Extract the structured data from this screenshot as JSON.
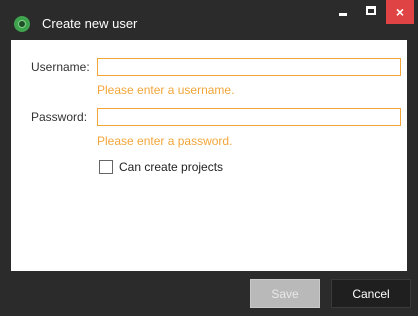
{
  "window": {
    "title": "Create new user",
    "controls": {
      "minimize_icon": "minimize-icon",
      "maximize_icon": "maximize-icon",
      "close_icon": "close-icon",
      "close_glyph": "×"
    }
  },
  "form": {
    "username": {
      "label": "Username:",
      "value": "",
      "error": "Please enter a username."
    },
    "password": {
      "label": "Password:",
      "value": "",
      "error": "Please enter a password."
    },
    "can_create_projects": {
      "label": "Can create projects",
      "checked": false
    }
  },
  "footer": {
    "save_label": "Save",
    "save_enabled": false,
    "cancel_label": "Cancel"
  },
  "colors": {
    "chrome": "#2b2b2b",
    "accent_error": "#f2a63a",
    "close_button": "#e04343",
    "app_icon": "#3fa34d"
  }
}
